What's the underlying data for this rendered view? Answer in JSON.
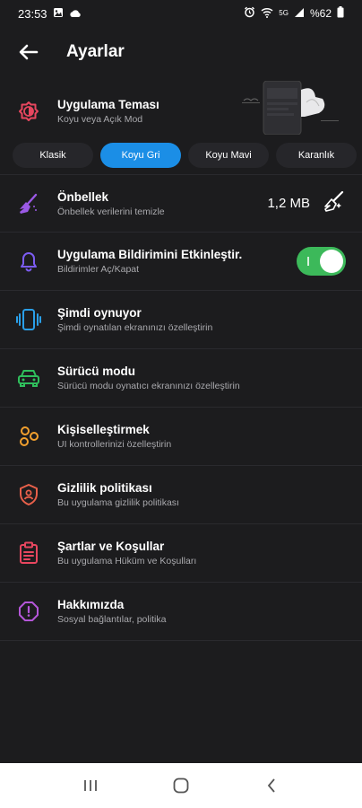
{
  "status": {
    "time": "23:53",
    "battery": "%62",
    "network": "5G"
  },
  "header": {
    "title": "Ayarlar"
  },
  "theme": {
    "title": "Uygulama Teması",
    "subtitle": "Koyu veya Açık Mod",
    "options": [
      "Klasik",
      "Koyu Gri",
      "Koyu Mavi",
      "Karanlık"
    ],
    "selected": "Koyu Gri"
  },
  "items": [
    {
      "title": "Önbellek",
      "subtitle": "Önbellek verilerini temizle",
      "value": "1,2 MB",
      "icon": "broom-icon",
      "color": "#9b59e6"
    },
    {
      "title": "Uygulama Bildirimini Etkinleştir.",
      "subtitle": "Bildirimler Aç/Kapat",
      "toggle": true,
      "icon": "bell-icon",
      "color": "#7c5cf2"
    },
    {
      "title": "Şimdi oynuyor",
      "subtitle": "Şimdi oynatılan ekranınızı özelleştirin",
      "icon": "phone-vibrate-icon",
      "color": "#2a9fe8"
    },
    {
      "title": "Sürücü modu",
      "subtitle": "Sürücü modu oynatıcı ekranınızı özelleştirin",
      "icon": "car-icon",
      "color": "#2fbf5c"
    },
    {
      "title": "Kişiselleştirmek",
      "subtitle": "UI kontrollerinizi özelleştirin",
      "icon": "customize-icon",
      "color": "#f2a02e"
    },
    {
      "title": "Gizlilik politikası",
      "subtitle": "Bu uygulama gizlilik politikası",
      "icon": "shield-user-icon",
      "color": "#e8604a"
    },
    {
      "title": "Şartlar ve Koşullar",
      "subtitle": "Bu uygulama Hüküm ve Koşulları",
      "icon": "clipboard-icon",
      "color": "#e8465f"
    },
    {
      "title": "Hakkımızda",
      "subtitle": "Sosyal bağlantılar, politika",
      "icon": "info-icon",
      "color": "#b456d8"
    }
  ],
  "colors": {
    "accent": "#1b8ee6",
    "toggle_on": "#3cb95a",
    "theme_icon": "#e8465f"
  }
}
